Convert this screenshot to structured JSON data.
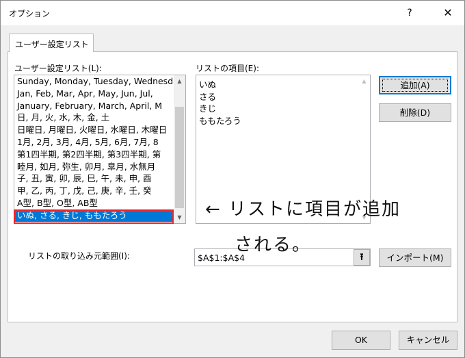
{
  "window": {
    "title": "オプション",
    "help_label": "?",
    "close_label": "✕"
  },
  "tab": {
    "label": "ユーザー設定リスト"
  },
  "custom_lists": {
    "label": "ユーザー設定リスト(L):",
    "items": [
      "Sunday, Monday, Tuesday, Wednesday",
      "Jan, Feb, Mar, Apr, May, Jun, Jul,",
      "January, February, March, April, M",
      "日, 月, 火, 水, 木, 金, 土",
      "日曜日, 月曜日, 火曜日, 水曜日, 木曜日",
      "1月, 2月, 3月, 4月, 5月, 6月, 7月, 8",
      "第1四半期, 第2四半期, 第3四半期, 第",
      "睦月, 如月, 弥生, 卯月, 皐月, 水無月",
      "子, 丑, 寅, 卯, 辰, 巳, 午, 未, 申, 酉",
      "甲, 乙, 丙, 丁, 戊, 己, 庚, 辛, 壬, 癸",
      "A型, B型, O型, AB型",
      "いぬ, さる, きじ, ももたろう"
    ],
    "selected_index": 11,
    "scroll_up": "▲",
    "scroll_down": "▼"
  },
  "list_entries": {
    "label": "リストの項目(E):",
    "lines": [
      "いぬ",
      "さる",
      "きじ",
      "ももたろう"
    ],
    "scroll_up": "▲",
    "scroll_down": "▼"
  },
  "buttons": {
    "add": "追加(A)",
    "delete": "削除(D)",
    "import": "インポート(M)",
    "ok": "OK",
    "cancel": "キャンセル"
  },
  "import_range": {
    "label": "リストの取り込み元範囲(I):",
    "value": "$A$1:$A$4",
    "collapse_icon": "⭱"
  },
  "annotation": {
    "line1": "← リストに項目が追加",
    "line2": "される。",
    "frame_color": "#e8262c"
  }
}
